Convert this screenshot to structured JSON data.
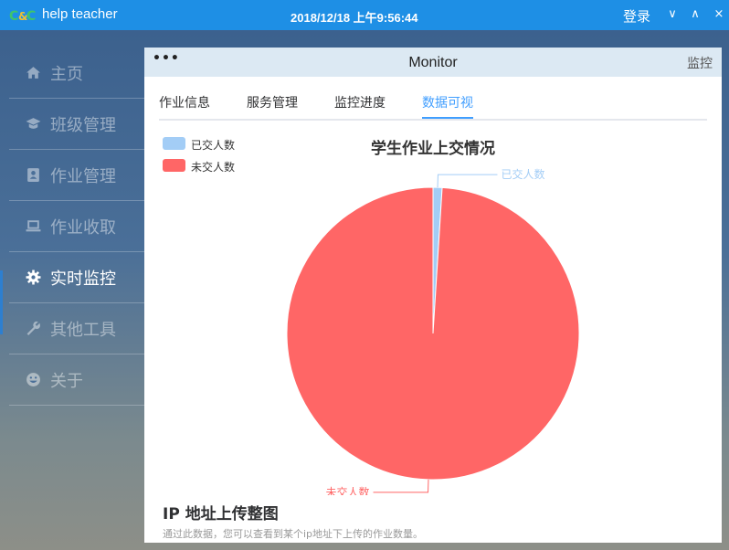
{
  "titlebar": {
    "app_name": "help teacher",
    "datetime": "2018/12/18 上午9:56:44",
    "login_label": "登录",
    "minimize_glyph": "∨",
    "maximize_glyph": "∧",
    "close_glyph": "×",
    "color": "#1e8fe5"
  },
  "sidebar": {
    "items": [
      {
        "label": "主页",
        "icon": "home-icon",
        "active": false
      },
      {
        "label": "班级管理",
        "icon": "graduation-cap-icon",
        "active": false
      },
      {
        "label": "作业管理",
        "icon": "address-book-icon",
        "active": false
      },
      {
        "label": "作业收取",
        "icon": "laptop-icon",
        "active": false
      },
      {
        "label": "实时监控",
        "icon": "gear-icon",
        "active": true
      },
      {
        "label": "其他工具",
        "icon": "wrench-icon",
        "active": false
      },
      {
        "label": "关于",
        "icon": "smile-icon",
        "active": false
      }
    ]
  },
  "panel": {
    "dots": "•••",
    "title": "Monitor",
    "corner_label": "监控",
    "tabs": [
      {
        "label": "作业信息",
        "active": false
      },
      {
        "label": "服务管理",
        "active": false
      },
      {
        "label": "监控进度",
        "active": false
      },
      {
        "label": "数据可视",
        "active": true
      }
    ],
    "accent_color": "#409eff"
  },
  "chart_data": {
    "type": "pie",
    "title": "学生作业上交情况",
    "legend_position": "top-left",
    "series": [
      {
        "name": "已交人数",
        "value": 1,
        "color": "#a3cdf6"
      },
      {
        "name": "未交人数",
        "value": 99,
        "color": "#ff6666"
      }
    ]
  },
  "section": {
    "title": "IP 地址上传整图",
    "description": "通过此数据，您可以查看到某个ip地址下上传的作业数量。"
  }
}
